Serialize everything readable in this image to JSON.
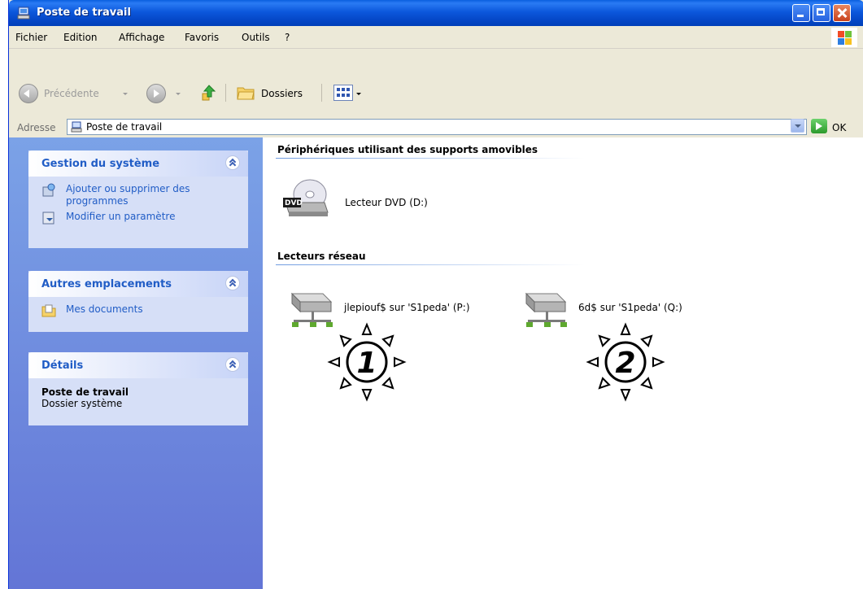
{
  "window": {
    "title": "Poste de travail"
  },
  "menu": [
    "Fichier",
    "Edition",
    "Affichage",
    "Favoris",
    "Outils",
    "?"
  ],
  "toolbar": {
    "back_label": "Précédente",
    "folders_label": "Dossiers"
  },
  "address": {
    "label": "Adresse",
    "value": "Poste de travail",
    "go_label": "OK"
  },
  "tasks_panel": {
    "title": "Gestion du système",
    "items": [
      "Ajouter ou supprimer des programmes",
      "Modifier un paramètre"
    ]
  },
  "places_panel": {
    "title": "Autres emplacements",
    "items": [
      "Mes documents"
    ]
  },
  "details_panel": {
    "title": "Détails",
    "name": "Poste de travail",
    "type": "Dossier système"
  },
  "sections": {
    "removable": {
      "title": "Périphériques utilisant des supports amovibles",
      "items": [
        {
          "label": "Lecteur DVD (D:)",
          "icon": "dvd-drive-icon"
        }
      ]
    },
    "network": {
      "title": "Lecteurs réseau",
      "items": [
        {
          "label": "jlepiouf$ sur 'S1peda' (P:)",
          "icon": "network-drive-icon",
          "marker": "1"
        },
        {
          "label": "6d$ sur 'S1peda' (Q:)",
          "icon": "network-drive-icon",
          "marker": "2"
        }
      ]
    }
  },
  "colors": {
    "titlebar": "#0a5fde",
    "taskpane": "#7ba2e7",
    "link": "#215dc6"
  }
}
